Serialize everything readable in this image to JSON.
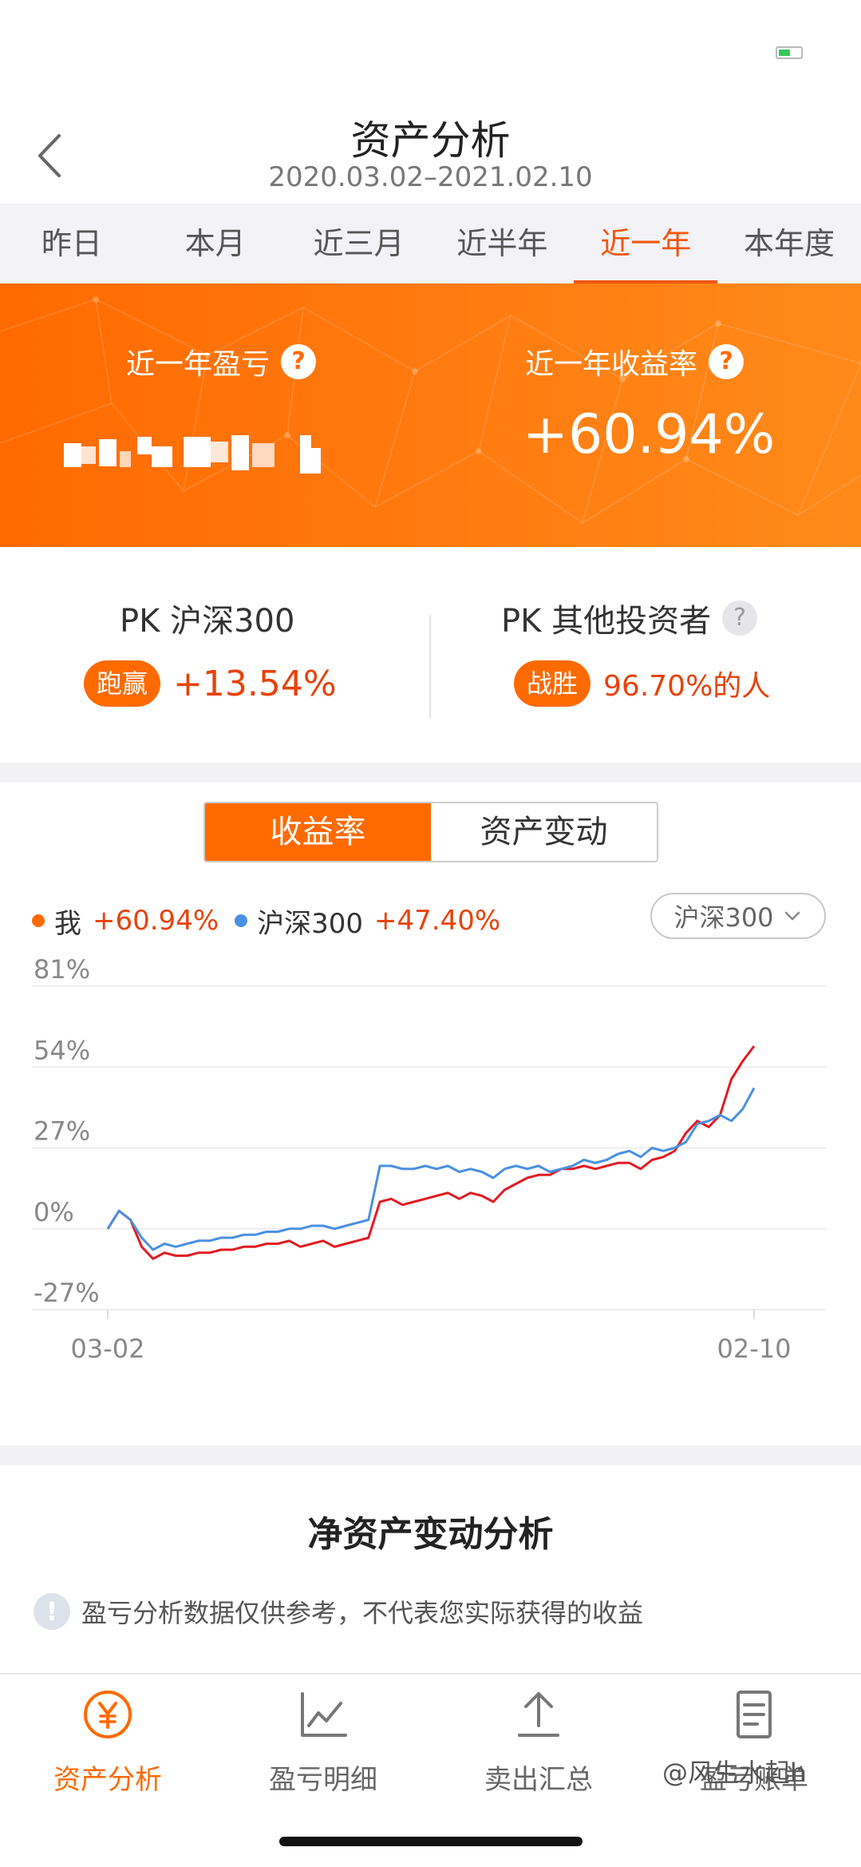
{
  "status_bar": {
    "battery_color": "#34c759"
  },
  "nav": {
    "title": "资产分析",
    "date_range": "2020.03.02–2021.02.10"
  },
  "tabs": [
    {
      "label": "昨日",
      "active": false
    },
    {
      "label": "本月",
      "active": false
    },
    {
      "label": "近三月",
      "active": false
    },
    {
      "label": "近半年",
      "active": false
    },
    {
      "label": "近一年",
      "active": true
    },
    {
      "label": "本年度",
      "active": false
    }
  ],
  "hero": {
    "pnl_label": "近一年盈亏",
    "pnl_value_hidden": true,
    "rate_label": "近一年收益率",
    "rate_value": "+60.94%",
    "help_glyph": "?"
  },
  "pk": {
    "left_title": "PK 沪深300",
    "left_badge": "跑赢",
    "left_value": "+13.54%",
    "right_title": "PK 其他投资者",
    "right_badge": "战胜",
    "right_value": "96.70%的人",
    "help_glyph": "?"
  },
  "chart_panel": {
    "tab_return": "收益率",
    "tab_assets": "资产变动",
    "benchmark_select": "沪深300"
  },
  "chart_data": {
    "type": "line",
    "x_labels": [
      "03-02",
      "02-10"
    ],
    "ylim": [
      -27,
      81
    ],
    "y_ticks": [
      "81%",
      "54%",
      "27%",
      "0%",
      "-27%"
    ],
    "grid": true,
    "legend_position": "top-left",
    "series": [
      {
        "name": "我",
        "final_label": "+60.94%",
        "color": "#e31b23",
        "values": [
          0,
          6,
          3,
          -6,
          -10,
          -8,
          -9,
          -9,
          -8,
          -8,
          -7,
          -7,
          -6,
          -6,
          -5,
          -5,
          -4,
          -6,
          -5,
          -4,
          -6,
          -5,
          -4,
          -3,
          9,
          10,
          8,
          9,
          10,
          11,
          12,
          10,
          12,
          11,
          9,
          13,
          15,
          17,
          18,
          18,
          20,
          20,
          21,
          20,
          21,
          22,
          22,
          20,
          23,
          24,
          26,
          32,
          36,
          34,
          38,
          50,
          56,
          61
        ]
      },
      {
        "name": "沪深300",
        "final_label": "+47.40%",
        "color": "#4a90e2",
        "values": [
          0,
          6,
          3,
          -3,
          -7,
          -5,
          -6,
          -5,
          -4,
          -4,
          -3,
          -3,
          -2,
          -2,
          -1,
          -1,
          0,
          0,
          1,
          1,
          0,
          1,
          2,
          3,
          21,
          21,
          20,
          20,
          21,
          20,
          21,
          19,
          20,
          19,
          17,
          20,
          21,
          20,
          21,
          19,
          20,
          21,
          23,
          22,
          23,
          25,
          26,
          24,
          27,
          26,
          27,
          29,
          35,
          36,
          38,
          36,
          40,
          47
        ]
      }
    ]
  },
  "net_asset": {
    "title": "净资产变动分析",
    "info_glyph": "!",
    "disclaimer": "盈亏分析数据仅供参考，不代表您实际获得的收益"
  },
  "bottom_nav": [
    {
      "label": "资产分析",
      "icon": "yen-icon",
      "active": true
    },
    {
      "label": "盈亏明细",
      "icon": "line-chart-icon",
      "active": false
    },
    {
      "label": "卖出汇总",
      "icon": "upload-icon",
      "active": false
    },
    {
      "label": "盈亏账单",
      "icon": "bill-icon",
      "active": false
    }
  ],
  "watermark": "@风生水起h",
  "colors": {
    "accent": "#ff6a00",
    "gain": "#e8420a",
    "my_series": "#e31b23",
    "benchmark_series": "#4a90e2"
  }
}
